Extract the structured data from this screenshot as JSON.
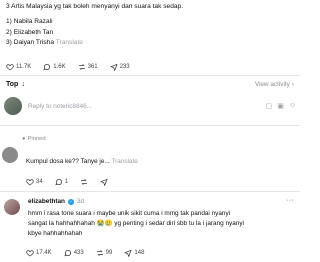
{
  "post": {
    "lines": [
      "3 Artis Malaysia yg tak boleh menyanyi dan suara tak sedap.",
      "",
      "1) Nabila Razali",
      "2) Elizabeth Tan",
      "3) Daiyan Trisha"
    ],
    "translate": "Translate",
    "stats": {
      "likes": "11.7K",
      "comments": "1.6K",
      "reposts": "361",
      "shares": "233"
    }
  },
  "sort": {
    "label": "Top",
    "view_activity": "View activity"
  },
  "composer": {
    "placeholder": "Reply to noteric8846..."
  },
  "comment1": {
    "pinned_label": "Pinned",
    "text": "Kumpul dosa ke?? Tanye je...",
    "translate": "Translate",
    "stats": {
      "likes": "34",
      "comments": "1"
    }
  },
  "comment2": {
    "username": "elizabethtan",
    "time": "3d",
    "lines": [
      "hmm i rasa tone suara i maybe unik sikit cuma i mmg tak pandai nyanyi",
      "sangat la hahhahhahah 😭🥲 yg penting i sedar diri sbb tu la i jarang nyanyi",
      "kbye hahhahhahah"
    ],
    "stats": {
      "likes": "17.4K",
      "comments": "433",
      "reposts": "99",
      "shares": "148"
    }
  },
  "icons": {
    "like": "heart-icon",
    "comment": "comment-icon",
    "repost": "repost-icon",
    "share": "share-icon",
    "verified": "verified-badge-icon"
  },
  "colors": {
    "verified": "#1d9bf0",
    "muted": "#8a8d91"
  }
}
